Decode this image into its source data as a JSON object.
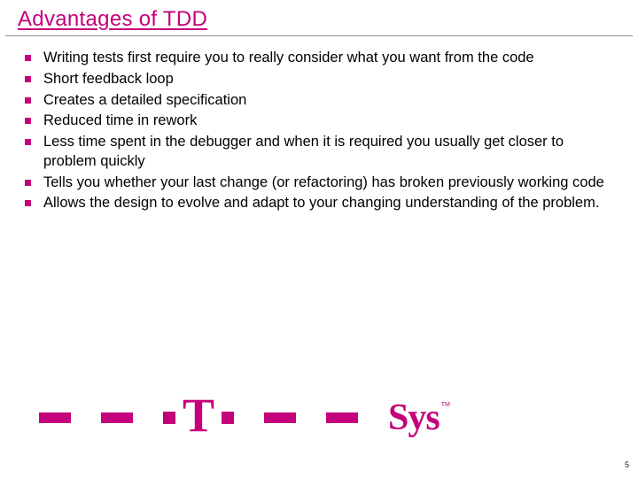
{
  "title": "Advantages of TDD",
  "bullets": [
    "Writing tests first require you to really consider what you want from the code",
    "Short feedback loop",
    "Creates a detailed specification",
    "Reduced time in rework",
    "Less time spent in the debugger and when it is required you usually get closer to problem quickly",
    "Tells you whether your last change (or refactoring) has broken previously working code",
    "Allows the design to evolve and adapt to your changing understanding of the problem."
  ],
  "logo": {
    "brand": "T",
    "suffix": "Sys",
    "tm": "TM"
  },
  "page_number": "5"
}
